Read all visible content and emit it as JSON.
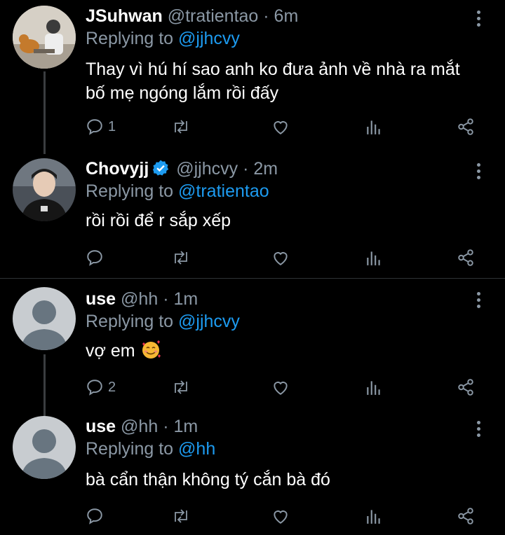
{
  "tweets": [
    {
      "name": "JSuhwan",
      "handle": "@tratientao",
      "time": "· 6m",
      "reply_prefix": "Replying to",
      "reply_to": "@jjhcvy",
      "text_lines": [
        "Thay vì hú hí sao anh ko đưa ảnh về nhà ra mắt",
        "bố mẹ ngóng lắm rồi đấy"
      ],
      "reply_count": "1",
      "verified": false
    },
    {
      "name": "Chovyjj",
      "handle": "@jjhcvy",
      "time": "· 2m",
      "reply_prefix": "Replying to",
      "reply_to": "@tratientao",
      "text_lines": [
        "rồi rồi để r sắp xếp"
      ],
      "reply_count": "",
      "verified": true
    },
    {
      "name": "use",
      "handle": "@hh",
      "time": "· 1m",
      "reply_prefix": "Replying to",
      "reply_to": "@jjhcvy",
      "text_lines": [
        "vợ em"
      ],
      "emoji": "smiling-face-with-hearts",
      "reply_count": "2",
      "verified": false
    },
    {
      "name": "use",
      "handle": "@hh",
      "time": "· 1m",
      "reply_prefix": "Replying to",
      "reply_to": "@hh",
      "text_lines": [
        "bà cẩn thận không tý cắn bà đó"
      ],
      "reply_count": "",
      "verified": false
    }
  ],
  "icons": {
    "reply": "reply-icon",
    "retweet": "retweet-icon",
    "like": "heart-icon",
    "stats": "stats-icon",
    "share": "share-icon",
    "more": "more-vertical-icon"
  },
  "colors": {
    "background": "#000000",
    "text": "#ffffff",
    "secondary": "#8b98a5",
    "link": "#1d9bf0"
  }
}
